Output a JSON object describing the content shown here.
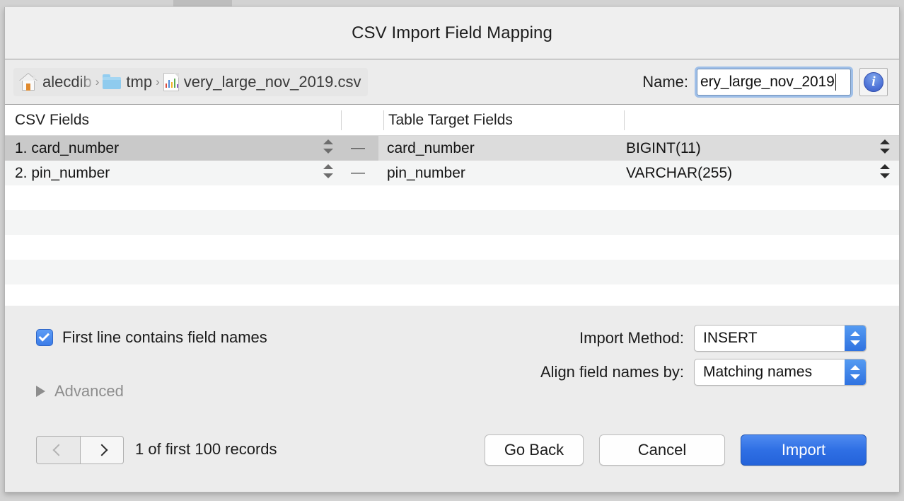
{
  "window": {
    "title": "CSV Import Field Mapping"
  },
  "pathbar": {
    "crumbs": [
      {
        "icon": "home-icon",
        "label": "alecdib"
      },
      {
        "icon": "folder-icon",
        "label": "tmp"
      },
      {
        "icon": "csv-file-icon",
        "label": "very_large_nov_2019.csv"
      }
    ],
    "separator": "›",
    "name_label": "Name:",
    "name_value": "ery_large_nov_2019",
    "info_glyph": "i"
  },
  "table": {
    "headers": [
      "CSV Fields",
      "",
      "Table Target Fields",
      ""
    ],
    "rows": [
      {
        "csv_field": "1. card_number",
        "connector": "—",
        "target_field": "card_number",
        "type": "BIGINT(11)",
        "selected": true
      },
      {
        "csv_field": "2. pin_number",
        "connector": "—",
        "target_field": "pin_number",
        "type": "VARCHAR(255)",
        "selected": false
      }
    ],
    "empty_rows": 4
  },
  "options": {
    "first_line_checkbox": {
      "label": "First line contains field names",
      "checked": true
    },
    "advanced": {
      "label": "Advanced",
      "expanded": false
    },
    "import_method": {
      "label": "Import Method:",
      "value": "INSERT"
    },
    "align_field_names": {
      "label": "Align field names by:",
      "value": "Matching names"
    }
  },
  "footer": {
    "prev_label": "‹",
    "next_label": "›",
    "record_count": "1 of first 100 records",
    "go_back": "Go Back",
    "cancel": "Cancel",
    "import": "Import"
  },
  "colors": {
    "accent_blue": "#2f6fe4",
    "checkbox_blue": "#3b7ce8",
    "window_bg": "#ececec",
    "selection_gray": "#c9c9c9",
    "alt_row": "#f4f5f5"
  }
}
